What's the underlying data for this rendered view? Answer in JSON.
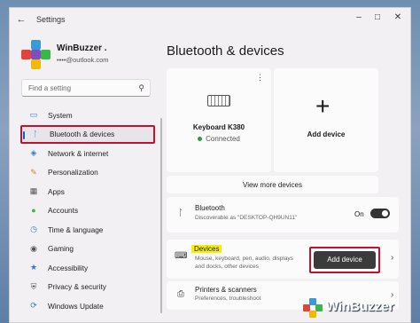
{
  "titlebar": {
    "title": "Settings"
  },
  "profile": {
    "name": "WinBuzzer .",
    "email": "••••@outlook.com"
  },
  "search": {
    "placeholder": "Find a setting"
  },
  "nav": {
    "items": [
      {
        "label": "System",
        "icon": "monitor-icon"
      },
      {
        "label": "Bluetooth & devices",
        "icon": "bluetooth-icon",
        "active": true
      },
      {
        "label": "Network & internet",
        "icon": "wifi-icon"
      },
      {
        "label": "Personalization",
        "icon": "brush-icon"
      },
      {
        "label": "Apps",
        "icon": "apps-icon"
      },
      {
        "label": "Accounts",
        "icon": "person-icon"
      },
      {
        "label": "Time & language",
        "icon": "globe-clock-icon"
      },
      {
        "label": "Gaming",
        "icon": "gamepad-icon"
      },
      {
        "label": "Accessibility",
        "icon": "accessibility-icon"
      },
      {
        "label": "Privacy & security",
        "icon": "shield-icon"
      },
      {
        "label": "Windows Update",
        "icon": "update-icon"
      }
    ]
  },
  "main": {
    "title": "Bluetooth & devices",
    "device_card": {
      "name": "Keyboard K380",
      "status": "Connected"
    },
    "add_card": {
      "label": "Add device"
    },
    "view_more": "View more devices",
    "bluetooth": {
      "title": "Bluetooth",
      "subtitle": "Discoverable as \"DESKTOP-QH9UN11\"",
      "state": "On"
    },
    "devices": {
      "title": "Devices",
      "subtitle": "Mouse, keyboard, pen, audio, displays and docks, other devices",
      "button": "Add device"
    },
    "printers": {
      "title": "Printers & scanners",
      "subtitle": "Preferences, troubleshoot"
    }
  },
  "watermark": {
    "text": "WinBuzzer"
  },
  "colors": {
    "accent": "#0067c0",
    "highlight_border": "#c8102e",
    "highlight_text": "#f7f000"
  }
}
